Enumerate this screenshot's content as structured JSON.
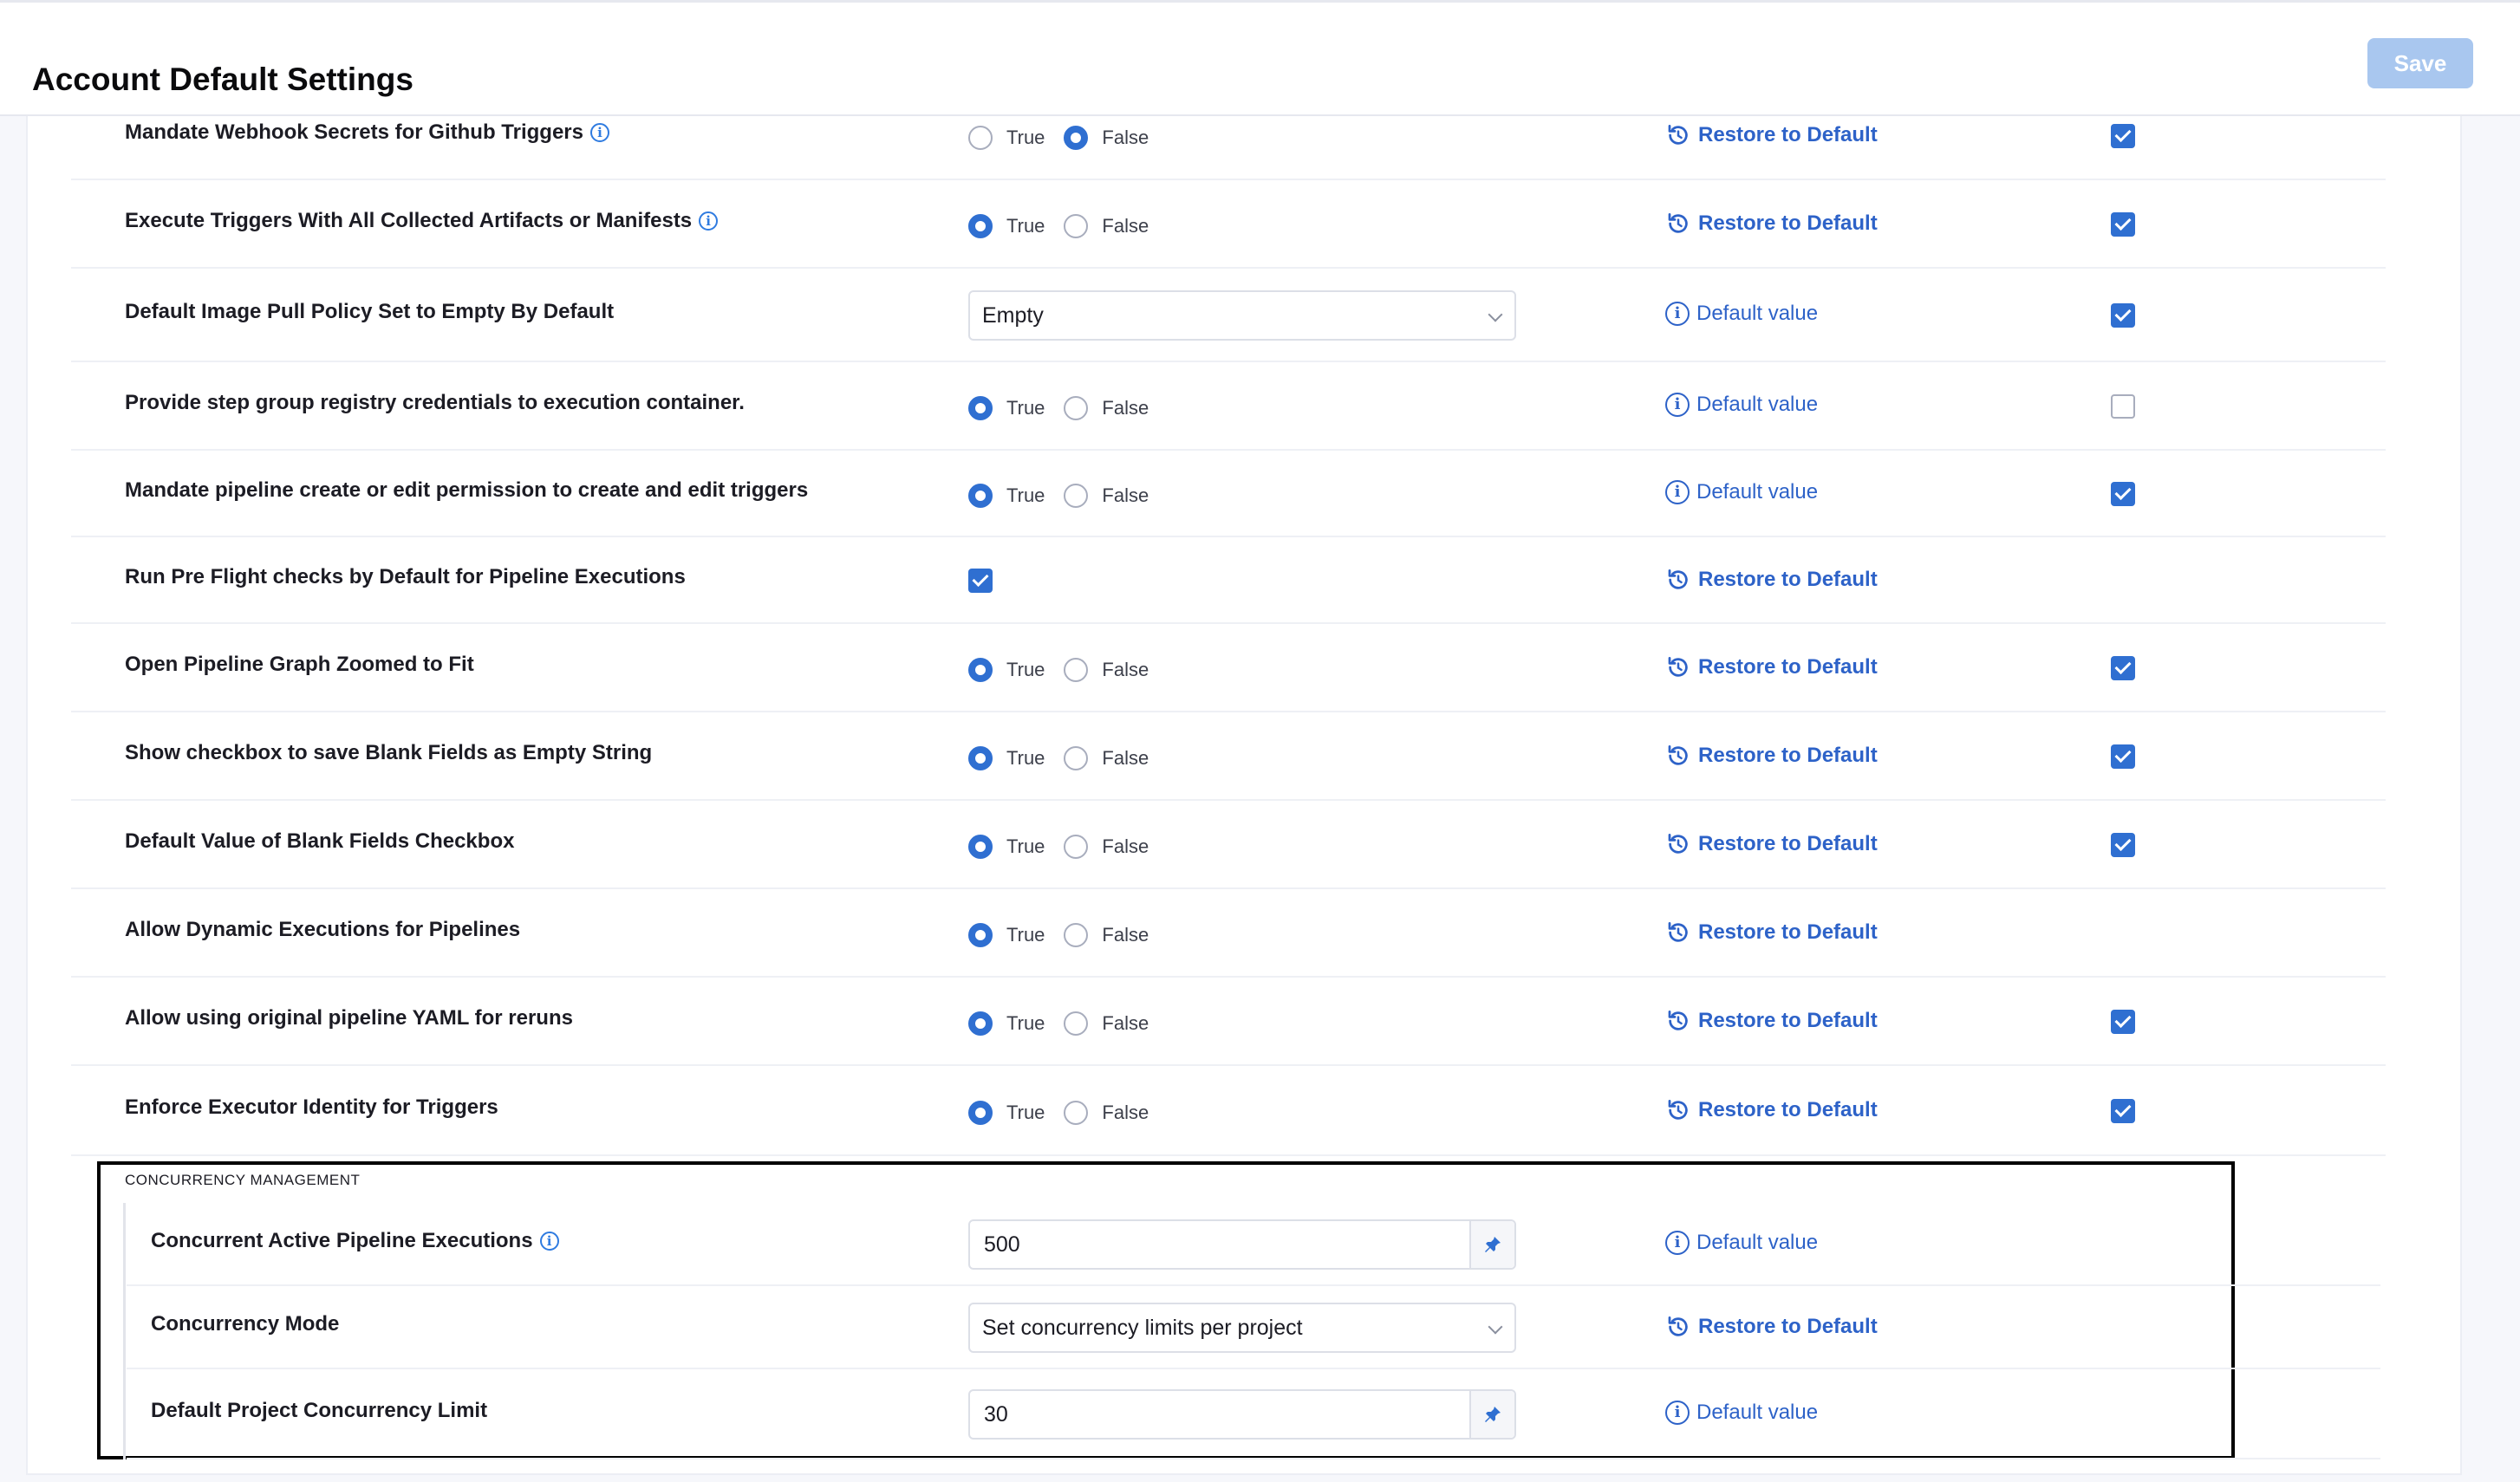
{
  "header": {
    "title": "Account Default Settings",
    "save_label": "Save"
  },
  "options": {
    "true": "True",
    "false": "False"
  },
  "actions": {
    "restore": "Restore to Default",
    "default": "Default value"
  },
  "settings": [
    {
      "label": "Mandate Webhook Secrets for Github Triggers",
      "info": true,
      "control": "radio",
      "value": "False",
      "action": "restore",
      "override": true
    },
    {
      "label": "Execute Triggers With All Collected Artifacts or Manifests",
      "info": true,
      "control": "radio",
      "value": "True",
      "action": "restore",
      "override": true
    },
    {
      "label": "Default Image Pull Policy Set to Empty By Default",
      "info": false,
      "control": "select",
      "value": "Empty",
      "action": "default",
      "override": true
    },
    {
      "label": "Provide step group registry credentials to execution container.",
      "info": false,
      "control": "radio",
      "value": "True",
      "action": "default",
      "override": false
    },
    {
      "label": "Mandate pipeline create or edit permission to create and edit triggers",
      "info": false,
      "control": "radio",
      "value": "True",
      "action": "default",
      "override": true
    },
    {
      "label": "Run Pre Flight checks by Default for Pipeline Executions",
      "info": false,
      "control": "checkbox",
      "value": true,
      "action": "restore",
      "override": null
    },
    {
      "label": "Open Pipeline Graph Zoomed to Fit",
      "info": false,
      "control": "radio",
      "value": "True",
      "action": "restore",
      "override": true
    },
    {
      "label": "Show checkbox to save Blank Fields as Empty String",
      "info": false,
      "control": "radio",
      "value": "True",
      "action": "restore",
      "override": true
    },
    {
      "label": "Default Value of Blank Fields Checkbox",
      "info": false,
      "control": "radio",
      "value": "True",
      "action": "restore",
      "override": true
    },
    {
      "label": "Allow Dynamic Executions for Pipelines",
      "info": false,
      "control": "radio",
      "value": "True",
      "action": "restore",
      "override": null
    },
    {
      "label": "Allow using original pipeline YAML for reruns",
      "info": false,
      "control": "radio",
      "value": "True",
      "action": "restore",
      "override": true
    },
    {
      "label": "Enforce Executor Identity for Triggers",
      "info": false,
      "control": "radio",
      "value": "True",
      "action": "restore",
      "override": true
    }
  ],
  "concurrency": {
    "title": "CONCURRENCY MANAGEMENT",
    "settings": [
      {
        "label": "Concurrent Active Pipeline Executions",
        "info": true,
        "control": "input",
        "value": "500",
        "action": "default"
      },
      {
        "label": "Concurrency Mode",
        "info": false,
        "control": "select",
        "value": "Set concurrency limits per project",
        "action": "restore"
      },
      {
        "label": "Default Project Concurrency Limit",
        "info": false,
        "control": "input",
        "value": "30",
        "action": "default"
      }
    ]
  },
  "icons": {
    "info": "info-circle-icon",
    "restore": "restore-icon",
    "pin": "pin-icon",
    "chevron": "chevron-down-icon"
  },
  "colors": {
    "accent": "#2f6fd1",
    "save_disabled": "#a9c7ef",
    "link": "#2d62c8"
  }
}
